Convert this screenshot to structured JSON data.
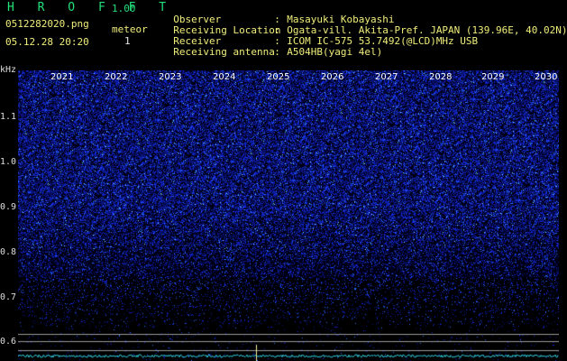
{
  "header": {
    "app_title": "H R O F F T",
    "version": "1.00",
    "filename": "0512282020.png",
    "timestamp": "05.12.28 20:20",
    "meteor_label": "meteor",
    "meteor_count": "1"
  },
  "info": [
    {
      "label": "Observer",
      "sep": ":",
      "value": "Masayuki Kobayashi"
    },
    {
      "label": "Receiving Location",
      "sep": ":",
      "value": "Ogata-vill. Akita-Pref. JAPAN (139.96E, 40.02N)"
    },
    {
      "label": "Receiver",
      "sep": ":",
      "value": "ICOM IC-575 53.7492(@LCD)MHz USB"
    },
    {
      "label": "Receiving antenna",
      "sep": ":",
      "value": "A504HB(yagi 4el)"
    }
  ],
  "axis": {
    "unit": "kHz",
    "y_ticks": [
      "1.1",
      "1.0",
      "0.9",
      "0.8",
      "0.7",
      "0.6"
    ],
    "years": [
      "2021",
      "2022",
      "2023",
      "2024",
      "2025",
      "2026",
      "2027",
      "2028",
      "2029",
      "2030"
    ]
  },
  "colors": {
    "title": "#22e07a",
    "info": "#f0ee7a",
    "spectrum_bright": "#3060ff",
    "spectrum_dim": "#0a1a80",
    "trace": "#30d0e0"
  }
}
